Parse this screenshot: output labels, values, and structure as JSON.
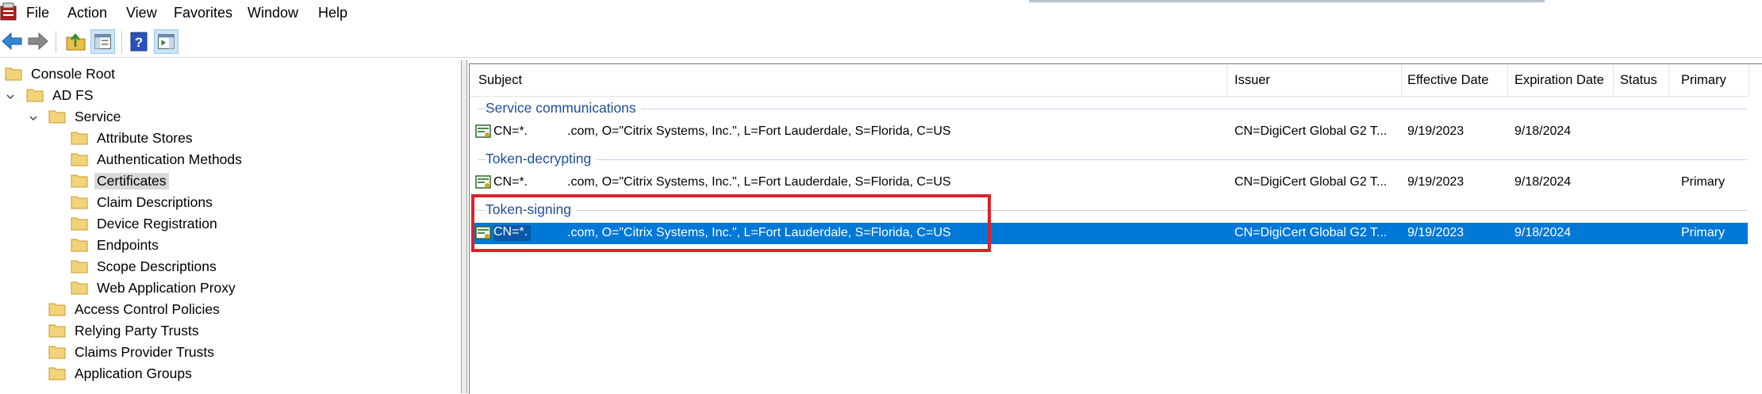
{
  "menu": [
    "File",
    "Action",
    "View",
    "Favorites",
    "Window",
    "Help"
  ],
  "colors": {
    "accent": "#0078d7",
    "group_text": "#1f4e9a",
    "highlight": "#e0202a"
  },
  "toolbar": {
    "icons": [
      "back-arrow-icon",
      "forward-arrow-icon",
      "up-folder-icon",
      "show-hide-console-tree-icon",
      "help-icon",
      "show-action-pane-icon"
    ]
  },
  "tree": {
    "items": [
      {
        "label": "Console Root",
        "depth": 0
      },
      {
        "label": "AD FS",
        "depth": 1,
        "expanded": true
      },
      {
        "label": "Service",
        "depth": 2,
        "expanded": true
      },
      {
        "label": "Attribute Stores",
        "depth": 3
      },
      {
        "label": "Authentication Methods",
        "depth": 3
      },
      {
        "label": "Certificates",
        "depth": 3,
        "selected": true
      },
      {
        "label": "Claim Descriptions",
        "depth": 3
      },
      {
        "label": "Device Registration",
        "depth": 3
      },
      {
        "label": "Endpoints",
        "depth": 3
      },
      {
        "label": "Scope Descriptions",
        "depth": 3
      },
      {
        "label": "Web Application Proxy",
        "depth": 3
      },
      {
        "label": "Access Control Policies",
        "depth": 2
      },
      {
        "label": "Relying Party Trusts",
        "depth": 2
      },
      {
        "label": "Claims Provider Trusts",
        "depth": 2
      },
      {
        "label": "Application Groups",
        "depth": 2
      }
    ]
  },
  "list": {
    "columns": [
      "Subject",
      "Issuer",
      "Effective Date",
      "Expiration Date",
      "Status",
      "Primary"
    ],
    "groups": [
      {
        "title": "Service communications",
        "rows": [
          {
            "subject_a": "CN=*.",
            "subject_b": ".com, O=\"Citrix Systems, Inc.\", L=Fort Lauderdale, S=Florida, C=US",
            "issuer": "CN=DigiCert Global G2 T...",
            "effective": "9/19/2023",
            "expiration": "9/18/2024",
            "status": "",
            "primary": ""
          }
        ]
      },
      {
        "title": "Token-decrypting",
        "rows": [
          {
            "subject_a": "CN=*.",
            "subject_b": ".com, O=\"Citrix Systems, Inc.\", L=Fort Lauderdale, S=Florida, C=US",
            "issuer": "CN=DigiCert Global G2 T...",
            "effective": "9/19/2023",
            "expiration": "9/18/2024",
            "status": "",
            "primary": "Primary"
          }
        ]
      },
      {
        "title": "Token-signing",
        "rows": [
          {
            "subject_a": "CN=*.",
            "subject_b": ".com, O=\"Citrix Systems, Inc.\", L=Fort Lauderdale, S=Florida, C=US",
            "issuer": "CN=DigiCert Global G2 T...",
            "effective": "9/19/2023",
            "expiration": "9/18/2024",
            "status": "",
            "primary": "Primary",
            "selected": true
          }
        ]
      }
    ]
  }
}
